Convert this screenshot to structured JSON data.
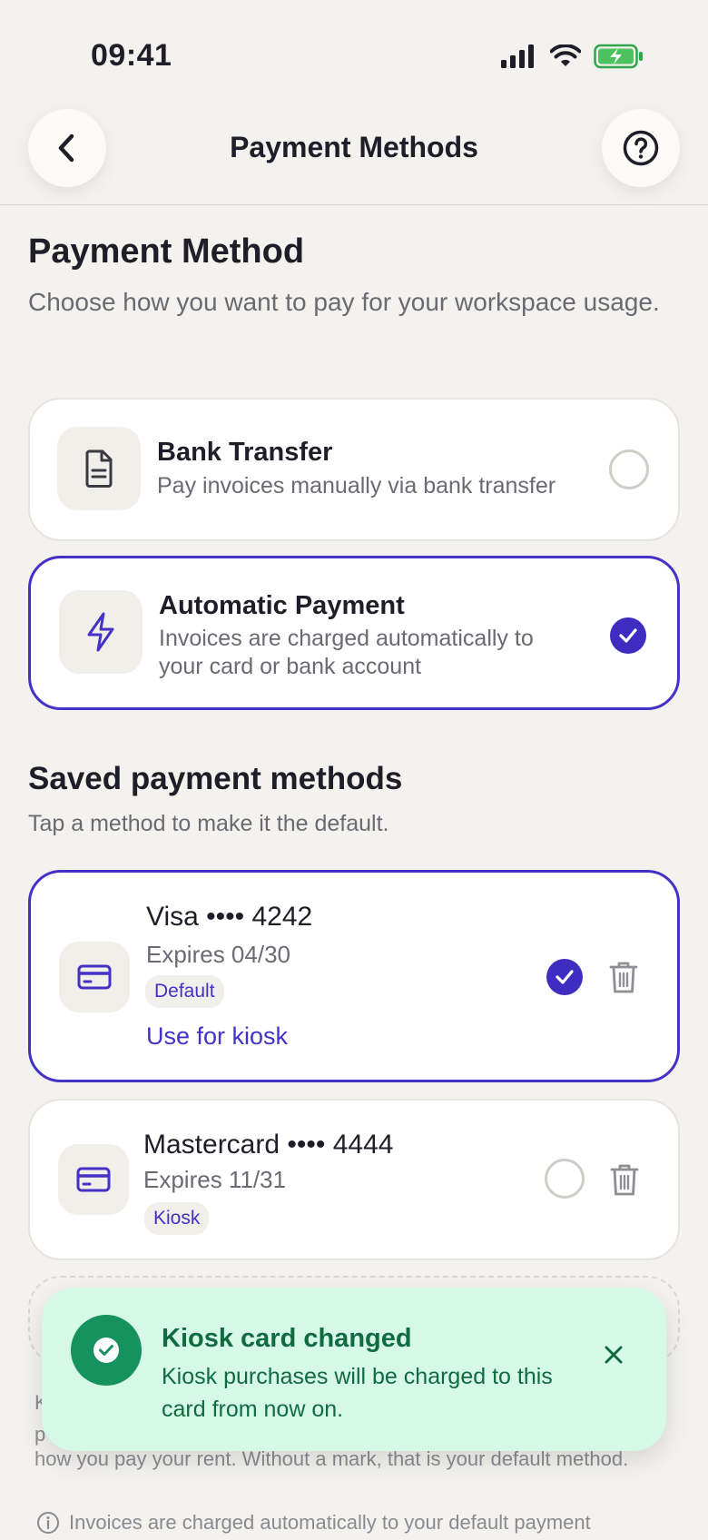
{
  "status_bar": {
    "time": "09:41"
  },
  "nav": {
    "title": "Payment Methods"
  },
  "payment_method": {
    "heading": "Payment Method",
    "subtitle": "Choose how you want to pay for your workspace usage.",
    "options": [
      {
        "title": "Bank Transfer",
        "description": "Pay invoices manually via bank transfer",
        "selected": false,
        "icon": "document-icon"
      },
      {
        "title": "Automatic Payment",
        "description": "Invoices are charged automatically to your card or bank account",
        "selected": true,
        "icon": "lightning-icon"
      }
    ]
  },
  "saved_methods": {
    "heading": "Saved payment methods",
    "subtitle": "Tap a method to make it the default.",
    "items": [
      {
        "title": "Visa •••• 4242",
        "expires": "Expires 04/30",
        "badge": "Default",
        "link": "Use for kiosk",
        "selected": true
      },
      {
        "title": "Mastercard •••• 4444",
        "expires": "Expires 11/31",
        "badge": "Kiosk",
        "selected": false
      }
    ]
  },
  "footnote": {
    "line1": "K",
    "line2": "p",
    "line3": "how you pay your rent. Without a mark, that is your default method.",
    "info": "Invoices are charged automatically to your default payment"
  },
  "toast": {
    "title": "Kiosk card changed",
    "body": "Kiosk purchases will be charged to this card from now on."
  },
  "colors": {
    "accent": "#4431c6",
    "toast_bg": "#d6f8e6",
    "toast_text": "#116b42",
    "background": "#f3f2ef"
  }
}
